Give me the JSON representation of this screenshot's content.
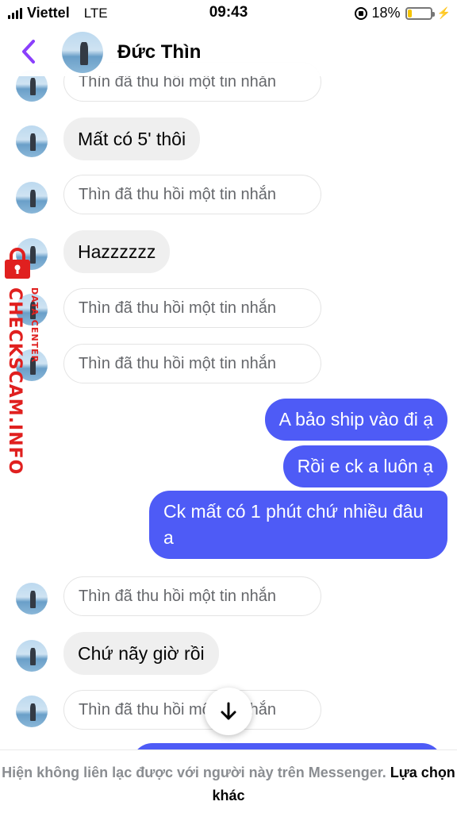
{
  "status_bar": {
    "carrier": "Viettel",
    "network": "LTE",
    "time": "09:43",
    "battery_percent": "18%",
    "battery_level": 0.18
  },
  "header": {
    "contact_name": "Đức Thìn",
    "back_icon": "chevron-left-icon",
    "accent_color": "#8a3ffc"
  },
  "messages": [
    {
      "type": "recalled",
      "text": "Thìn đã thu hồi một tin nhắn"
    },
    {
      "type": "incoming",
      "text": "Mất có 5' thôi"
    },
    {
      "type": "recalled",
      "text": "Thìn đã thu hồi một tin nhắn"
    },
    {
      "type": "incoming",
      "text": "Hazzzzzz"
    },
    {
      "type": "recalled",
      "text": "Thìn đã thu hồi một tin nhắn"
    },
    {
      "type": "recalled",
      "text": "Thìn đã thu hồi một tin nhắn"
    },
    {
      "type": "outgoing",
      "text": "A bảo ship vào đi ạ"
    },
    {
      "type": "outgoing",
      "text": "Rồi e ck a luôn ạ"
    },
    {
      "type": "outgoing",
      "text": "Ck mất có 1 phút chứ nhiều đâu a"
    },
    {
      "type": "recalled",
      "text": "Thìn đã thu hồi một tin nhắn"
    },
    {
      "type": "incoming",
      "text": "Chứ nãy giờ rồi"
    },
    {
      "type": "recalled",
      "text": "Thìn đã thu hồi một tin nhắn"
    }
  ],
  "scroll_button_icon": "arrow-down-icon",
  "footer": {
    "note": "Hiện không liên lạc được với người này trên Messenger.",
    "action": "Lựa chọn khác"
  },
  "watermark": {
    "main": "CHECKSCAM.INFO",
    "sub": "DATA CENTER"
  },
  "colors": {
    "outgoing_bubble": "#4e5bf6",
    "incoming_bubble": "#efefef",
    "watermark": "#e0201f"
  }
}
